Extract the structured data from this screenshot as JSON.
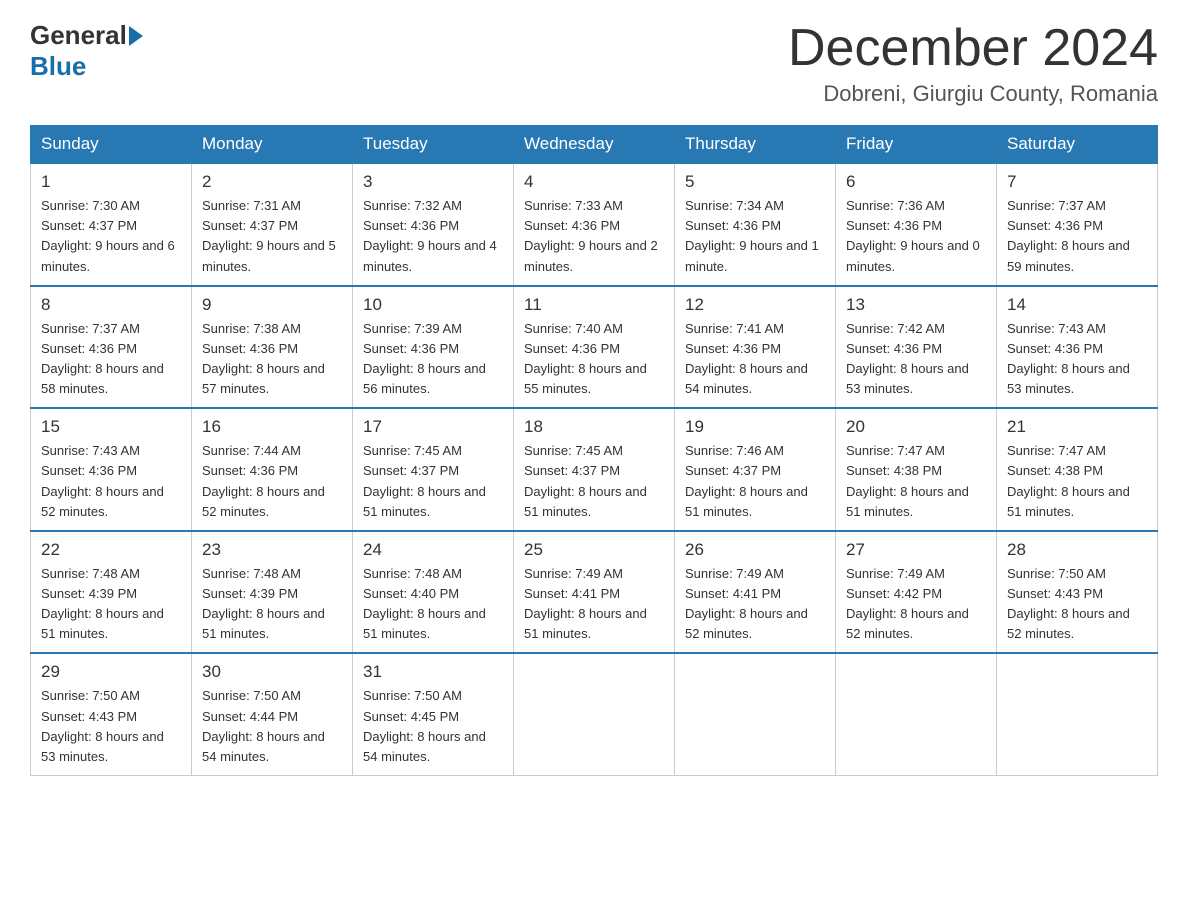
{
  "header": {
    "logo": {
      "general": "General",
      "blue": "Blue"
    },
    "title": "December 2024",
    "location": "Dobreni, Giurgiu County, Romania"
  },
  "weekdays": [
    "Sunday",
    "Monday",
    "Tuesday",
    "Wednesday",
    "Thursday",
    "Friday",
    "Saturday"
  ],
  "weeks": [
    [
      {
        "day": "1",
        "sunrise": "7:30 AM",
        "sunset": "4:37 PM",
        "daylight": "9 hours and 6 minutes."
      },
      {
        "day": "2",
        "sunrise": "7:31 AM",
        "sunset": "4:37 PM",
        "daylight": "9 hours and 5 minutes."
      },
      {
        "day": "3",
        "sunrise": "7:32 AM",
        "sunset": "4:36 PM",
        "daylight": "9 hours and 4 minutes."
      },
      {
        "day": "4",
        "sunrise": "7:33 AM",
        "sunset": "4:36 PM",
        "daylight": "9 hours and 2 minutes."
      },
      {
        "day": "5",
        "sunrise": "7:34 AM",
        "sunset": "4:36 PM",
        "daylight": "9 hours and 1 minute."
      },
      {
        "day": "6",
        "sunrise": "7:36 AM",
        "sunset": "4:36 PM",
        "daylight": "9 hours and 0 minutes."
      },
      {
        "day": "7",
        "sunrise": "7:37 AM",
        "sunset": "4:36 PM",
        "daylight": "8 hours and 59 minutes."
      }
    ],
    [
      {
        "day": "8",
        "sunrise": "7:37 AM",
        "sunset": "4:36 PM",
        "daylight": "8 hours and 58 minutes."
      },
      {
        "day": "9",
        "sunrise": "7:38 AM",
        "sunset": "4:36 PM",
        "daylight": "8 hours and 57 minutes."
      },
      {
        "day": "10",
        "sunrise": "7:39 AM",
        "sunset": "4:36 PM",
        "daylight": "8 hours and 56 minutes."
      },
      {
        "day": "11",
        "sunrise": "7:40 AM",
        "sunset": "4:36 PM",
        "daylight": "8 hours and 55 minutes."
      },
      {
        "day": "12",
        "sunrise": "7:41 AM",
        "sunset": "4:36 PM",
        "daylight": "8 hours and 54 minutes."
      },
      {
        "day": "13",
        "sunrise": "7:42 AM",
        "sunset": "4:36 PM",
        "daylight": "8 hours and 53 minutes."
      },
      {
        "day": "14",
        "sunrise": "7:43 AM",
        "sunset": "4:36 PM",
        "daylight": "8 hours and 53 minutes."
      }
    ],
    [
      {
        "day": "15",
        "sunrise": "7:43 AM",
        "sunset": "4:36 PM",
        "daylight": "8 hours and 52 minutes."
      },
      {
        "day": "16",
        "sunrise": "7:44 AM",
        "sunset": "4:36 PM",
        "daylight": "8 hours and 52 minutes."
      },
      {
        "day": "17",
        "sunrise": "7:45 AM",
        "sunset": "4:37 PM",
        "daylight": "8 hours and 51 minutes."
      },
      {
        "day": "18",
        "sunrise": "7:45 AM",
        "sunset": "4:37 PM",
        "daylight": "8 hours and 51 minutes."
      },
      {
        "day": "19",
        "sunrise": "7:46 AM",
        "sunset": "4:37 PM",
        "daylight": "8 hours and 51 minutes."
      },
      {
        "day": "20",
        "sunrise": "7:47 AM",
        "sunset": "4:38 PM",
        "daylight": "8 hours and 51 minutes."
      },
      {
        "day": "21",
        "sunrise": "7:47 AM",
        "sunset": "4:38 PM",
        "daylight": "8 hours and 51 minutes."
      }
    ],
    [
      {
        "day": "22",
        "sunrise": "7:48 AM",
        "sunset": "4:39 PM",
        "daylight": "8 hours and 51 minutes."
      },
      {
        "day": "23",
        "sunrise": "7:48 AM",
        "sunset": "4:39 PM",
        "daylight": "8 hours and 51 minutes."
      },
      {
        "day": "24",
        "sunrise": "7:48 AM",
        "sunset": "4:40 PM",
        "daylight": "8 hours and 51 minutes."
      },
      {
        "day": "25",
        "sunrise": "7:49 AM",
        "sunset": "4:41 PM",
        "daylight": "8 hours and 51 minutes."
      },
      {
        "day": "26",
        "sunrise": "7:49 AM",
        "sunset": "4:41 PM",
        "daylight": "8 hours and 52 minutes."
      },
      {
        "day": "27",
        "sunrise": "7:49 AM",
        "sunset": "4:42 PM",
        "daylight": "8 hours and 52 minutes."
      },
      {
        "day": "28",
        "sunrise": "7:50 AM",
        "sunset": "4:43 PM",
        "daylight": "8 hours and 52 minutes."
      }
    ],
    [
      {
        "day": "29",
        "sunrise": "7:50 AM",
        "sunset": "4:43 PM",
        "daylight": "8 hours and 53 minutes."
      },
      {
        "day": "30",
        "sunrise": "7:50 AM",
        "sunset": "4:44 PM",
        "daylight": "8 hours and 54 minutes."
      },
      {
        "day": "31",
        "sunrise": "7:50 AM",
        "sunset": "4:45 PM",
        "daylight": "8 hours and 54 minutes."
      },
      null,
      null,
      null,
      null
    ]
  ]
}
